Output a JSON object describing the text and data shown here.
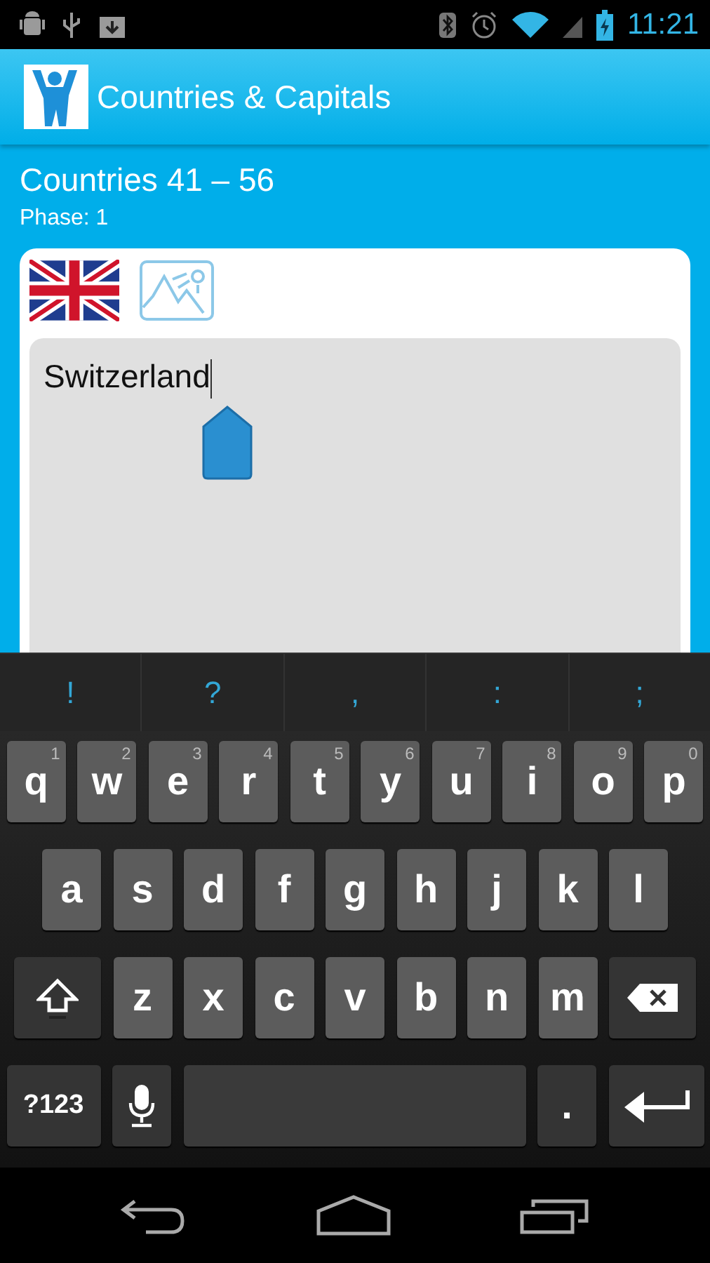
{
  "status_bar": {
    "time": "11:21"
  },
  "app_bar": {
    "title": "Countries & Capitals"
  },
  "heading": "Countries 41 – 56",
  "phase": "Phase: 1",
  "card": {
    "answer": "Switzerland"
  },
  "keyboard": {
    "suggestions": [
      "!",
      "?",
      ",",
      ":",
      ";"
    ],
    "rows": [
      {
        "keys": [
          {
            "kind": "letter",
            "label": "q",
            "hint": "1"
          },
          {
            "kind": "letter",
            "label": "w",
            "hint": "2"
          },
          {
            "kind": "letter",
            "label": "e",
            "hint": "3"
          },
          {
            "kind": "letter",
            "label": "r",
            "hint": "4"
          },
          {
            "kind": "letter",
            "label": "t",
            "hint": "5"
          },
          {
            "kind": "letter",
            "label": "y",
            "hint": "6"
          },
          {
            "kind": "letter",
            "label": "u",
            "hint": "7"
          },
          {
            "kind": "letter",
            "label": "i",
            "hint": "8"
          },
          {
            "kind": "letter",
            "label": "o",
            "hint": "9"
          },
          {
            "kind": "letter",
            "label": "p",
            "hint": "0"
          }
        ]
      },
      {
        "keys": [
          {
            "kind": "letter",
            "label": "a"
          },
          {
            "kind": "letter",
            "label": "s"
          },
          {
            "kind": "letter",
            "label": "d"
          },
          {
            "kind": "letter",
            "label": "f"
          },
          {
            "kind": "letter",
            "label": "g"
          },
          {
            "kind": "letter",
            "label": "h"
          },
          {
            "kind": "letter",
            "label": "j"
          },
          {
            "kind": "letter",
            "label": "k"
          },
          {
            "kind": "letter",
            "label": "l"
          }
        ]
      },
      {
        "keys": [
          {
            "kind": "shift"
          },
          {
            "kind": "letter",
            "label": "z"
          },
          {
            "kind": "letter",
            "label": "x"
          },
          {
            "kind": "letter",
            "label": "c"
          },
          {
            "kind": "letter",
            "label": "v"
          },
          {
            "kind": "letter",
            "label": "b"
          },
          {
            "kind": "letter",
            "label": "n"
          },
          {
            "kind": "letter",
            "label": "m"
          },
          {
            "kind": "delete"
          }
        ]
      },
      {
        "keys": [
          {
            "kind": "symbols",
            "label": "?123"
          },
          {
            "kind": "mic"
          },
          {
            "kind": "space"
          },
          {
            "kind": "period",
            "label": "."
          },
          {
            "kind": "enter"
          }
        ]
      }
    ]
  }
}
